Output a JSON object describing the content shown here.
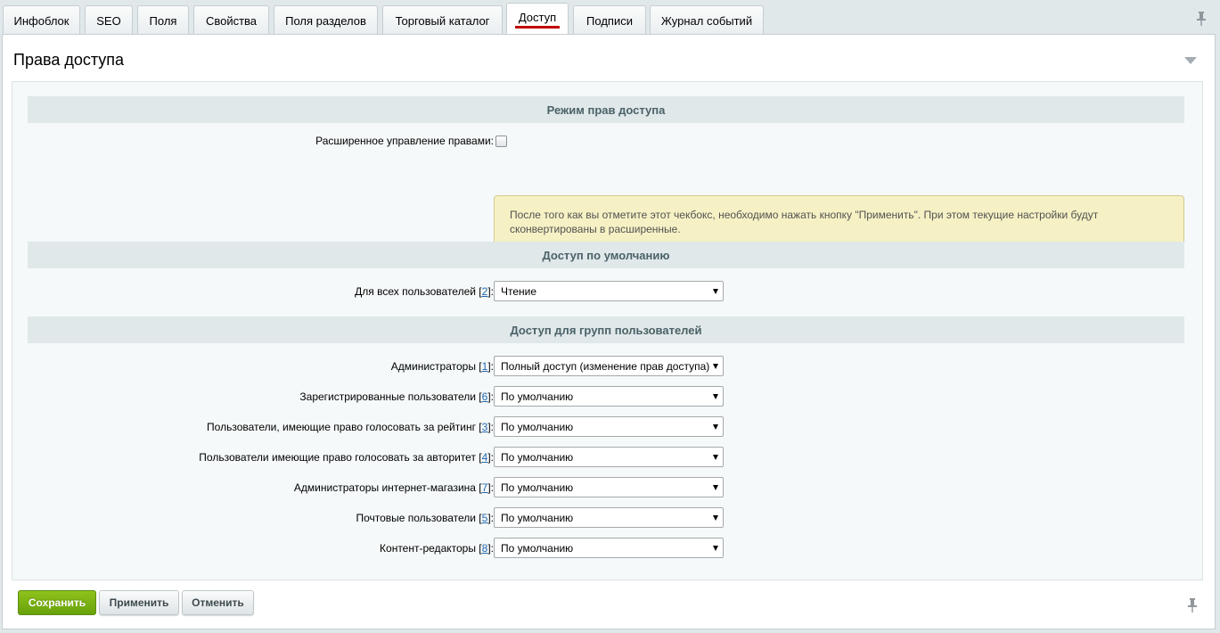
{
  "tabs": [
    {
      "label": "Инфоблок"
    },
    {
      "label": "SEO"
    },
    {
      "label": "Поля"
    },
    {
      "label": "Свойства"
    },
    {
      "label": "Поля разделов"
    },
    {
      "label": "Торговый каталог"
    },
    {
      "label": "Доступ",
      "active": true
    },
    {
      "label": "Подписи"
    },
    {
      "label": "Журнал событий"
    }
  ],
  "panel": {
    "title": "Права доступа"
  },
  "mode_section": {
    "heading": "Режим прав доступа",
    "extended_label": "Расширенное управление правами:",
    "extended_checked": false,
    "notice": "После того как вы отметите этот чекбокс, необходимо нажать кнопку \"Применить\". При этом текущие настройки будут сконвертированы в расширенные."
  },
  "default_section": {
    "heading": "Доступ по умолчанию",
    "label": "Для всех пользователей",
    "num": "2",
    "value": "Чтение"
  },
  "groups_section": {
    "heading": "Доступ для групп пользователей",
    "rows": [
      {
        "label": "Администраторы",
        "num": "1",
        "value": "Полный доступ (изменение прав доступа)"
      },
      {
        "label": "Зарегистрированные пользователи",
        "num": "6",
        "value": "По умолчанию"
      },
      {
        "label": "Пользователи, имеющие право голосовать за рейтинг",
        "num": "3",
        "value": "По умолчанию"
      },
      {
        "label": "Пользователи имеющие право голосовать за авторитет",
        "num": "4",
        "value": "По умолчанию"
      },
      {
        "label": "Администраторы интернет-магазина",
        "num": "7",
        "value": "По умолчанию"
      },
      {
        "label": "Почтовые пользователи",
        "num": "5",
        "value": "По умолчанию"
      },
      {
        "label": "Контент-редакторы",
        "num": "8",
        "value": "По умолчанию"
      }
    ]
  },
  "buttons": {
    "save": "Сохранить",
    "apply": "Применить",
    "cancel": "Отменить"
  }
}
